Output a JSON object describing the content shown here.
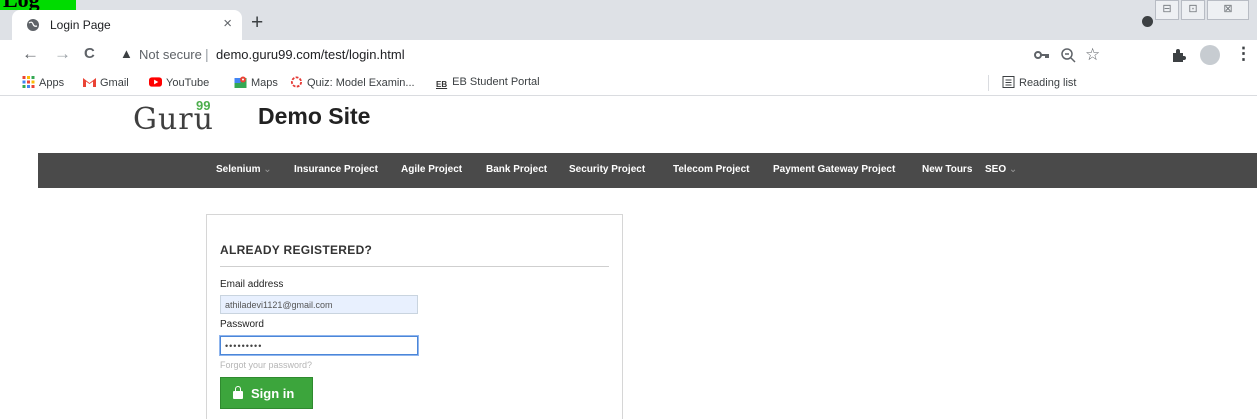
{
  "corner_mark": "Log",
  "browser": {
    "tab_title": "Login Page",
    "tab_close": "×",
    "new_tab": "+",
    "nav": {
      "back": "←",
      "forward": "→",
      "reload": "C"
    },
    "omnibox": {
      "security_label": "Not secure",
      "separator": "|",
      "url": "demo.guru99.com/test/login.html"
    },
    "window_controls": [
      "⊟",
      "⊡",
      "⊠"
    ],
    "toolbar_icons": [
      "key-icon",
      "zoom-icon",
      "star-icon",
      "extensions-icon",
      "avatar-icon",
      "menu-icon"
    ],
    "menu_glyph": "⋮",
    "bookmarks": [
      {
        "label": "Apps",
        "icon": "apps-grid-icon"
      },
      {
        "label": "Gmail",
        "icon": "gmail-icon"
      },
      {
        "label": "YouTube",
        "icon": "youtube-icon"
      },
      {
        "label": "Maps",
        "icon": "maps-icon"
      },
      {
        "label": "Quiz: Model Examin...",
        "icon": "quiz-icon"
      },
      {
        "label": "EB Student Portal",
        "icon": "eb-icon"
      }
    ],
    "eb_icon_text": "EB",
    "reading_list": "Reading list"
  },
  "site": {
    "logo_text": "Guru",
    "logo_sup": "99",
    "title": "Demo Site",
    "nav_caret": "⌄",
    "nav": [
      {
        "label": "Selenium",
        "dropdown": true
      },
      {
        "label": "Insurance Project",
        "dropdown": false
      },
      {
        "label": "Agile Project",
        "dropdown": false
      },
      {
        "label": "Bank Project",
        "dropdown": false
      },
      {
        "label": "Security Project",
        "dropdown": false
      },
      {
        "label": "Telecom Project",
        "dropdown": false
      },
      {
        "label": "Payment Gateway Project",
        "dropdown": false
      },
      {
        "label": "New Tours",
        "dropdown": false
      },
      {
        "label": "SEO",
        "dropdown": true
      }
    ]
  },
  "login": {
    "heading": "ALREADY REGISTERED?",
    "email_label": "Email address",
    "email_value": "athiladevi1121@gmail.com",
    "password_label": "Password",
    "password_value": "•••••••••",
    "forgot": "Forgot your password?",
    "signin_label": "Sign in"
  },
  "colors": {
    "nav_bg": "#4a4a4a",
    "button_green": "#3ca53c",
    "logo_accent": "#4cae4c",
    "input_autofill": "#e8f0fe"
  }
}
